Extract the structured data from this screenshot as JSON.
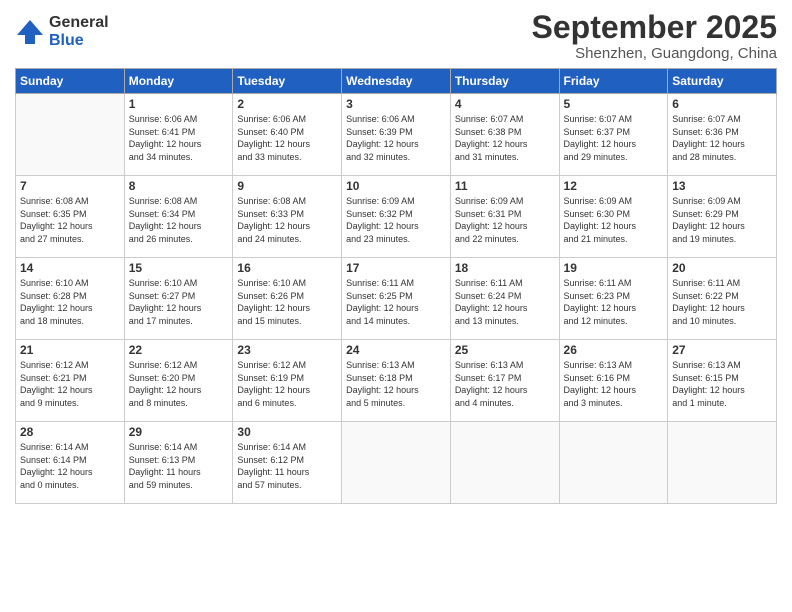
{
  "logo": {
    "general": "General",
    "blue": "Blue"
  },
  "header": {
    "month": "September 2025",
    "location": "Shenzhen, Guangdong, China"
  },
  "weekdays": [
    "Sunday",
    "Monday",
    "Tuesday",
    "Wednesday",
    "Thursday",
    "Friday",
    "Saturday"
  ],
  "weeks": [
    [
      {
        "day": "",
        "info": ""
      },
      {
        "day": "1",
        "info": "Sunrise: 6:06 AM\nSunset: 6:41 PM\nDaylight: 12 hours\nand 34 minutes."
      },
      {
        "day": "2",
        "info": "Sunrise: 6:06 AM\nSunset: 6:40 PM\nDaylight: 12 hours\nand 33 minutes."
      },
      {
        "day": "3",
        "info": "Sunrise: 6:06 AM\nSunset: 6:39 PM\nDaylight: 12 hours\nand 32 minutes."
      },
      {
        "day": "4",
        "info": "Sunrise: 6:07 AM\nSunset: 6:38 PM\nDaylight: 12 hours\nand 31 minutes."
      },
      {
        "day": "5",
        "info": "Sunrise: 6:07 AM\nSunset: 6:37 PM\nDaylight: 12 hours\nand 29 minutes."
      },
      {
        "day": "6",
        "info": "Sunrise: 6:07 AM\nSunset: 6:36 PM\nDaylight: 12 hours\nand 28 minutes."
      }
    ],
    [
      {
        "day": "7",
        "info": "Sunrise: 6:08 AM\nSunset: 6:35 PM\nDaylight: 12 hours\nand 27 minutes."
      },
      {
        "day": "8",
        "info": "Sunrise: 6:08 AM\nSunset: 6:34 PM\nDaylight: 12 hours\nand 26 minutes."
      },
      {
        "day": "9",
        "info": "Sunrise: 6:08 AM\nSunset: 6:33 PM\nDaylight: 12 hours\nand 24 minutes."
      },
      {
        "day": "10",
        "info": "Sunrise: 6:09 AM\nSunset: 6:32 PM\nDaylight: 12 hours\nand 23 minutes."
      },
      {
        "day": "11",
        "info": "Sunrise: 6:09 AM\nSunset: 6:31 PM\nDaylight: 12 hours\nand 22 minutes."
      },
      {
        "day": "12",
        "info": "Sunrise: 6:09 AM\nSunset: 6:30 PM\nDaylight: 12 hours\nand 21 minutes."
      },
      {
        "day": "13",
        "info": "Sunrise: 6:09 AM\nSunset: 6:29 PM\nDaylight: 12 hours\nand 19 minutes."
      }
    ],
    [
      {
        "day": "14",
        "info": "Sunrise: 6:10 AM\nSunset: 6:28 PM\nDaylight: 12 hours\nand 18 minutes."
      },
      {
        "day": "15",
        "info": "Sunrise: 6:10 AM\nSunset: 6:27 PM\nDaylight: 12 hours\nand 17 minutes."
      },
      {
        "day": "16",
        "info": "Sunrise: 6:10 AM\nSunset: 6:26 PM\nDaylight: 12 hours\nand 15 minutes."
      },
      {
        "day": "17",
        "info": "Sunrise: 6:11 AM\nSunset: 6:25 PM\nDaylight: 12 hours\nand 14 minutes."
      },
      {
        "day": "18",
        "info": "Sunrise: 6:11 AM\nSunset: 6:24 PM\nDaylight: 12 hours\nand 13 minutes."
      },
      {
        "day": "19",
        "info": "Sunrise: 6:11 AM\nSunset: 6:23 PM\nDaylight: 12 hours\nand 12 minutes."
      },
      {
        "day": "20",
        "info": "Sunrise: 6:11 AM\nSunset: 6:22 PM\nDaylight: 12 hours\nand 10 minutes."
      }
    ],
    [
      {
        "day": "21",
        "info": "Sunrise: 6:12 AM\nSunset: 6:21 PM\nDaylight: 12 hours\nand 9 minutes."
      },
      {
        "day": "22",
        "info": "Sunrise: 6:12 AM\nSunset: 6:20 PM\nDaylight: 12 hours\nand 8 minutes."
      },
      {
        "day": "23",
        "info": "Sunrise: 6:12 AM\nSunset: 6:19 PM\nDaylight: 12 hours\nand 6 minutes."
      },
      {
        "day": "24",
        "info": "Sunrise: 6:13 AM\nSunset: 6:18 PM\nDaylight: 12 hours\nand 5 minutes."
      },
      {
        "day": "25",
        "info": "Sunrise: 6:13 AM\nSunset: 6:17 PM\nDaylight: 12 hours\nand 4 minutes."
      },
      {
        "day": "26",
        "info": "Sunrise: 6:13 AM\nSunset: 6:16 PM\nDaylight: 12 hours\nand 3 minutes."
      },
      {
        "day": "27",
        "info": "Sunrise: 6:13 AM\nSunset: 6:15 PM\nDaylight: 12 hours\nand 1 minute."
      }
    ],
    [
      {
        "day": "28",
        "info": "Sunrise: 6:14 AM\nSunset: 6:14 PM\nDaylight: 12 hours\nand 0 minutes."
      },
      {
        "day": "29",
        "info": "Sunrise: 6:14 AM\nSunset: 6:13 PM\nDaylight: 11 hours\nand 59 minutes."
      },
      {
        "day": "30",
        "info": "Sunrise: 6:14 AM\nSunset: 6:12 PM\nDaylight: 11 hours\nand 57 minutes."
      },
      {
        "day": "",
        "info": ""
      },
      {
        "day": "",
        "info": ""
      },
      {
        "day": "",
        "info": ""
      },
      {
        "day": "",
        "info": ""
      }
    ]
  ]
}
